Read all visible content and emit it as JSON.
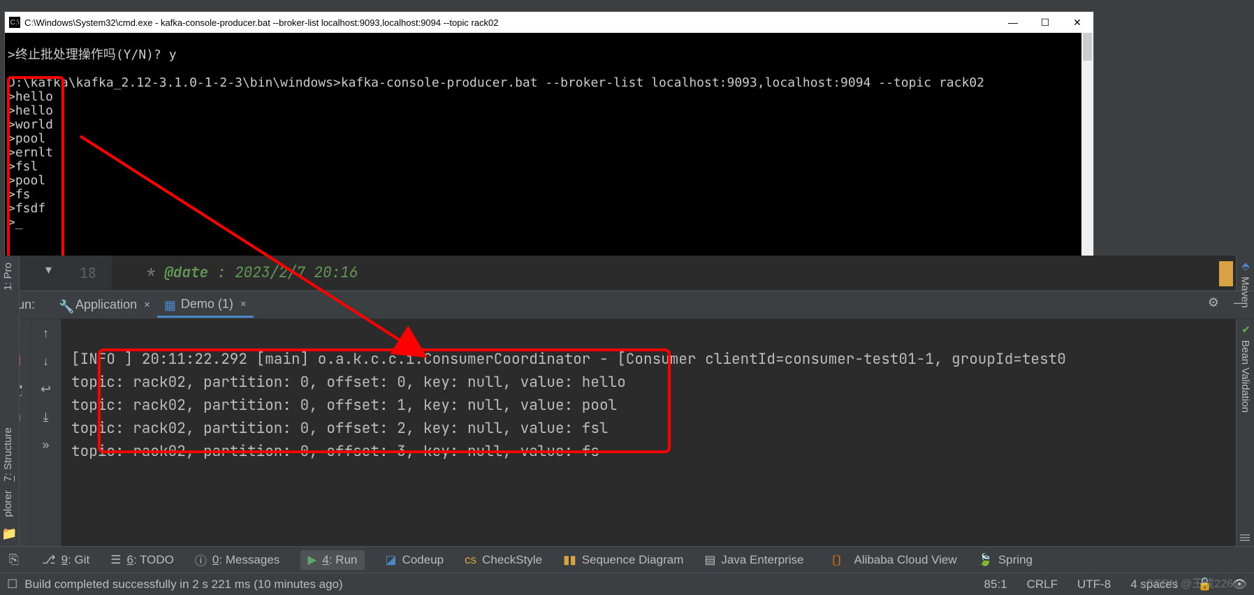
{
  "cmd": {
    "title": "C:\\Windows\\System32\\cmd.exe - kafka-console-producer.bat  --broker-list localhost:9093,localhost:9094 --topic rack02",
    "line_prompt": ">终止批处理操作吗(Y/N)? y",
    "line_blank": "",
    "line_path": "D:\\kafka\\kafka_2.12-3.1.0-1-2-3\\bin\\windows>kafka-console-producer.bat --broker-list localhost:9093,localhost:9094 --topic rack02",
    "inputs": [
      ">hello",
      ">hello",
      ">world",
      ">pool",
      ">ernlt",
      ">fsl",
      ">pool",
      ">fs",
      ">fsdf",
      ">_"
    ]
  },
  "editor": {
    "line_no": "18",
    "star": "* ",
    "tag": "@date",
    "sep": " : ",
    "val": "2023/2/7 20:16"
  },
  "run": {
    "title": "Run:",
    "tabs": [
      {
        "label": "Application",
        "active": false
      },
      {
        "label": "Demo (1)",
        "active": true
      }
    ],
    "info_line": "[INFO ] 20:11:22.292 [main] o.a.k.c.c.i.ConsumerCoordinator - [Consumer clientId=consumer-test01-1, groupId=test0",
    "rows": [
      "topic: rack02, partition: 0, offset: 0, key: null, value: hello",
      "topic: rack02, partition: 0, offset: 1, key: null, value: pool",
      "topic: rack02, partition: 0, offset: 2, key: null, value: fsl",
      "topic: rack02, partition: 0, offset: 3, key: null, value: fs"
    ]
  },
  "toolwins": {
    "git": "9: Git",
    "todo": "6: TODO",
    "messages": "0: Messages",
    "run": "4: Run",
    "codeup": "Codeup",
    "checkstyle": "CheckStyle",
    "seq": "Sequence Diagram",
    "javaee": "Java Enterprise",
    "alibaba": "Alibaba Cloud View",
    "spring": "Spring"
  },
  "status": {
    "build": "Build completed successfully in 2 s 221 ms (10 minutes ago)",
    "pos": "85:1",
    "eol": "CRLF",
    "enc": "UTF-8",
    "indent": "4 spaces"
  },
  "side": {
    "project": "1: Pro",
    "structure": "7: Structure",
    "plorer": "plorer",
    "maven": "Maven",
    "bean": "Bean Validation",
    "db": "|||"
  },
  "watermark": "CSDN @王成226"
}
